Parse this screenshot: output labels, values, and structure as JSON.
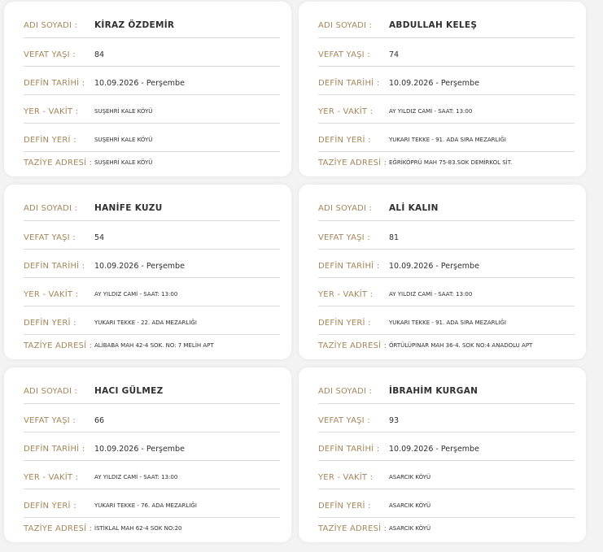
{
  "labels": {
    "name": "ADI SOYADI :",
    "age": "VEFAT YAŞI :",
    "burial_date": "DEFİN TARİHİ :",
    "place_time": "YER - VAKİT :",
    "burial_place": "DEFİN YERİ :",
    "condolence_address": "TAZİYE ADRESİ :"
  },
  "cards": [
    {
      "name": "KİRAZ ÖZDEMİR",
      "age": "84",
      "burial_date": "10.09.2026 - Perşembe",
      "place_time": "SUŞEHRİ KALE KÖYÜ",
      "burial_place": "SUŞEHRİ KALE KÖYÜ",
      "condolence_address": "SUŞEHRİ KALE KÖYÜ"
    },
    {
      "name": "ABDULLAH KELEŞ",
      "age": "74",
      "burial_date": "10.09.2026 - Perşembe",
      "place_time": "AY YILDIZ CAMİ - SAAT: 13:00",
      "burial_place": "YUKARI TEKKE - 91. ADA SIRA MEZARLIĞI",
      "condolence_address": "EĞRİKÖPRÜ MAH 75-83.SOK DEMİRKOL SİT."
    },
    {
      "name": "HANİFE KUZU",
      "age": "54",
      "burial_date": "10.09.2026 - Perşembe",
      "place_time": "AY YILDIZ CAMİ - SAAT: 13:00",
      "burial_place": "YUKARI TEKKE - 22. ADA MEZARLIĞI",
      "condolence_address": "ALİBABA MAH 42-4 SOK. NO: 7 MELİH APT"
    },
    {
      "name": "ALİ KALIN",
      "age": "81",
      "burial_date": "10.09.2026 - Perşembe",
      "place_time": "AY YILDIZ CAMİ - SAAT: 13:00",
      "burial_place": "YUKARI TEKKE - 91. ADA SIRA MEZARLIĞI",
      "condolence_address": "ÖRTÜLÜPINAR MAH 36-4. SOK NO:4 ANADOLU APT"
    },
    {
      "name": "HACI GÜLMEZ",
      "age": "66",
      "burial_date": "10.09.2026 - Perşembe",
      "place_time": "AY YILDIZ CAMİ - SAAT: 13:00",
      "burial_place": "YUKARI TEKKE - 76. ADA MEZARLIĞI",
      "condolence_address": "İSTİKLAL MAH 62-4 SOK NO:20"
    },
    {
      "name": "İBRAHİM KURGAN",
      "age": "93",
      "burial_date": "10.09.2026 - Perşembe",
      "place_time": "ASARCIK KÖYÜ",
      "burial_place": "ASARCIK KÖYÜ",
      "condolence_address": "ASARCIK KÖYÜ"
    }
  ],
  "colors": {
    "label": "#a5875b",
    "value": "#2f2f2f",
    "card": "#ffffff",
    "background": "#f3f3f3"
  }
}
